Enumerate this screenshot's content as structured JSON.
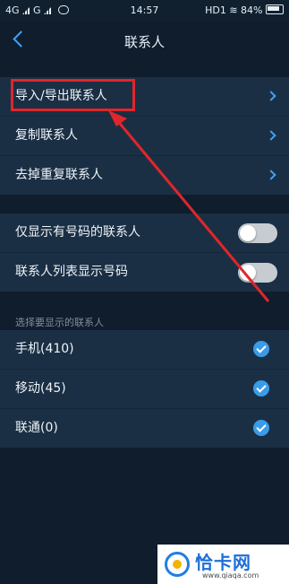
{
  "status_bar": {
    "left": "4G ııl G ııl",
    "time": "14:57",
    "hd": "HD1",
    "battery": "84%"
  },
  "header": {
    "title": "联系人"
  },
  "group1": {
    "items": [
      {
        "label": "导入/导出联系人"
      },
      {
        "label": "复制联系人"
      },
      {
        "label": "去掉重复联系人"
      }
    ]
  },
  "group2": {
    "items": [
      {
        "label": "仅显示有号码的联系人",
        "on": false
      },
      {
        "label": "联系人列表显示号码",
        "on": false
      }
    ]
  },
  "section": {
    "label": "选择要显示的联系人"
  },
  "group3": {
    "items": [
      {
        "label": "手机(410)",
        "checked": true
      },
      {
        "label": "移动(45)",
        "checked": true
      },
      {
        "label": "联通(0)",
        "checked": true
      }
    ]
  },
  "watermark": {
    "text": "恰卡网",
    "sub": "www.qiaqa.com"
  },
  "colors": {
    "accent": "#3fa2ff",
    "highlight": "#e0262b",
    "background": "#0f1d2d",
    "row": "#1b2f44"
  }
}
